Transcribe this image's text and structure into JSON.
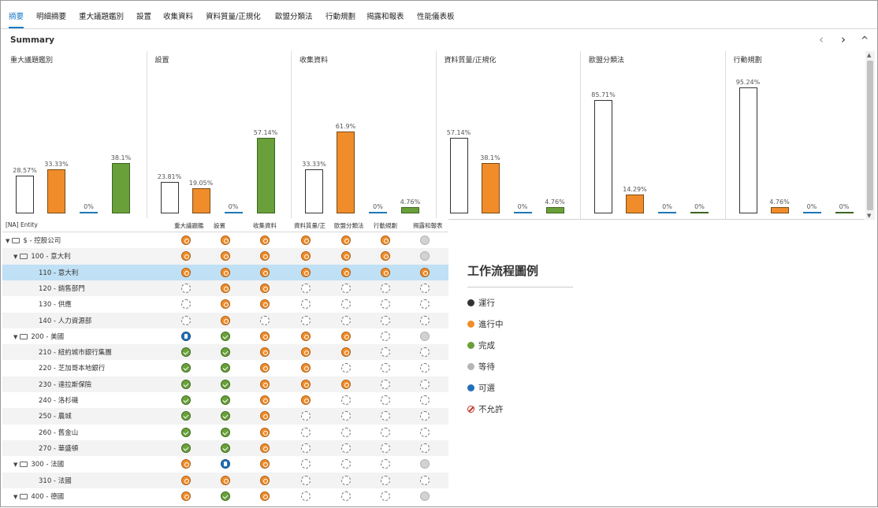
{
  "tabs": [
    "摘要",
    "明細摘要",
    "重大議題鑑別",
    "設置",
    "收集資料",
    "資料質量/正規化",
    "歐盟分類法",
    "行動規劃",
    "揭露和報表",
    "性能儀表板"
  ],
  "active_tab": 0,
  "summary": {
    "title": "Summary"
  },
  "nav": {
    "prev": "‹",
    "next": "›",
    "collapse": "^"
  },
  "status_colors": {
    "not_started": "#ffffff",
    "in_progress": "#f08d2a",
    "waiting": "#1f77b4",
    "done": "#69a03a"
  },
  "chart_data": [
    {
      "type": "bar",
      "title": "重大議題鑑別",
      "values": [
        28.57,
        33.33,
        0,
        38.1
      ],
      "labels": [
        "28.57%",
        "33.33%",
        "0%",
        "38.1%"
      ],
      "colors": [
        "#ffffff",
        "#f08d2a",
        "#1f77b4",
        "#69a03a"
      ],
      "ylim": [
        0,
        100
      ]
    },
    {
      "type": "bar",
      "title": "設置",
      "values": [
        23.81,
        19.05,
        0,
        57.14
      ],
      "labels": [
        "23.81%",
        "19.05%",
        "0%",
        "57.14%"
      ],
      "colors": [
        "#ffffff",
        "#f08d2a",
        "#1f77b4",
        "#69a03a"
      ],
      "ylim": [
        0,
        100
      ]
    },
    {
      "type": "bar",
      "title": "收集資料",
      "values": [
        33.33,
        61.9,
        0,
        4.76
      ],
      "labels": [
        "33.33%",
        "61.9%",
        "0%",
        "4.76%"
      ],
      "colors": [
        "#ffffff",
        "#f08d2a",
        "#1f77b4",
        "#69a03a"
      ],
      "ylim": [
        0,
        100
      ]
    },
    {
      "type": "bar",
      "title": "資料質量/正規化",
      "values": [
        57.14,
        38.1,
        0,
        4.76
      ],
      "labels": [
        "57.14%",
        "38.1%",
        "0%",
        "4.76%"
      ],
      "colors": [
        "#ffffff",
        "#f08d2a",
        "#1f77b4",
        "#69a03a"
      ],
      "ylim": [
        0,
        100
      ]
    },
    {
      "type": "bar",
      "title": "歐盟分類法",
      "values": [
        85.71,
        14.29,
        0,
        0
      ],
      "labels": [
        "85.71%",
        "14.29%",
        "0%",
        "0%"
      ],
      "colors": [
        "#ffffff",
        "#f08d2a",
        "#1f77b4",
        "#69a03a"
      ],
      "ylim": [
        0,
        100
      ]
    },
    {
      "type": "bar",
      "title": "行動規劃",
      "values": [
        95.24,
        4.76,
        0,
        0
      ],
      "labels": [
        "95.24%",
        "4.76%",
        "0%",
        "0%"
      ],
      "colors": [
        "#ffffff",
        "#f08d2a",
        "#1f77b4",
        "#69a03a"
      ],
      "ylim": [
        0,
        100
      ]
    }
  ],
  "grid": {
    "entity_header": "[NA] Entity",
    "columns": [
      "重大議題鑑",
      "設置",
      "收集資料",
      "資料質量/正",
      "歐盟分類法",
      "行動規劃",
      "揭露和報表"
    ],
    "rows": [
      {
        "label": "$ - 控股公司",
        "level": 0,
        "folder": true,
        "expanded": true,
        "status": [
          "ip",
          "ip",
          "ip",
          "ip",
          "ip",
          "ip",
          "wt"
        ]
      },
      {
        "label": "100 - 意大利",
        "level": 1,
        "folder": true,
        "expanded": true,
        "status": [
          "ip",
          "ip",
          "ip",
          "ip",
          "ip",
          "ip",
          "wt"
        ]
      },
      {
        "label": "110 - 意大利",
        "level": 2,
        "folder": false,
        "selected": true,
        "status": [
          "ip",
          "ip",
          "ip",
          "ip",
          "ip",
          "ip",
          "ip"
        ]
      },
      {
        "label": "120 - 銷售部門",
        "level": 2,
        "folder": false,
        "status": [
          "ns",
          "ip",
          "ip",
          "ns",
          "ns",
          "ns",
          "ns"
        ]
      },
      {
        "label": "130 - 供應",
        "level": 2,
        "folder": false,
        "status": [
          "ns",
          "ip",
          "ip",
          "ns",
          "ns",
          "ns",
          "ns"
        ]
      },
      {
        "label": "140 - 人力資源部",
        "level": 2,
        "folder": false,
        "status": [
          "ns",
          "ip",
          "ns",
          "ns",
          "ns",
          "ns",
          "ns"
        ]
      },
      {
        "label": "200 - 美國",
        "level": 1,
        "folder": true,
        "expanded": true,
        "status": [
          "op",
          "dn",
          "ip",
          "ip",
          "ip",
          "ns",
          "wt"
        ]
      },
      {
        "label": "210 - 紐約城市銀行集團",
        "level": 2,
        "folder": false,
        "status": [
          "dn",
          "dn",
          "ip",
          "ip",
          "ip",
          "ns",
          "ns"
        ]
      },
      {
        "label": "220 - 芝加哥本地銀行",
        "level": 2,
        "folder": false,
        "status": [
          "dn",
          "dn",
          "ip",
          "ip",
          "ns",
          "ns",
          "ns"
        ]
      },
      {
        "label": "230 - 達拉斯保險",
        "level": 2,
        "folder": false,
        "status": [
          "dn",
          "dn",
          "ip",
          "ip",
          "ip",
          "ns",
          "ns"
        ]
      },
      {
        "label": "240 - 洛杉磯",
        "level": 2,
        "folder": false,
        "status": [
          "dn",
          "dn",
          "ip",
          "ip",
          "ns",
          "ns",
          "ns"
        ]
      },
      {
        "label": "250 - 農城",
        "level": 2,
        "folder": false,
        "status": [
          "dn",
          "dn",
          "ip",
          "ns",
          "ns",
          "ns",
          "ns"
        ]
      },
      {
        "label": "260 - 舊金山",
        "level": 2,
        "folder": false,
        "status": [
          "dn",
          "dn",
          "ip",
          "ns",
          "ns",
          "ns",
          "ns"
        ]
      },
      {
        "label": "270 - 華盛頓",
        "level": 2,
        "folder": false,
        "status": [
          "dn",
          "dn",
          "ip",
          "ns",
          "ns",
          "ns",
          "ns"
        ]
      },
      {
        "label": "300 - 法國",
        "level": 1,
        "folder": true,
        "expanded": true,
        "status": [
          "ip",
          "op",
          "ip",
          "ns",
          "ns",
          "ns",
          "wt"
        ]
      },
      {
        "label": "310 - 法國",
        "level": 2,
        "folder": false,
        "status": [
          "ip",
          "ip",
          "ip",
          "ns",
          "ns",
          "ns",
          "ns"
        ]
      },
      {
        "label": "400 - 德國",
        "level": 1,
        "folder": true,
        "expanded": true,
        "status": [
          "ip",
          "dn",
          "ip",
          "ns",
          "ns",
          "ns",
          "wt"
        ]
      }
    ]
  },
  "legend": {
    "title": "工作流程圖例",
    "items": [
      {
        "label": "運行",
        "color": "#333333"
      },
      {
        "label": "進行中",
        "color": "#f08d2a"
      },
      {
        "label": "完成",
        "color": "#69a03a"
      },
      {
        "label": "等待",
        "color": "#b5b5b5"
      },
      {
        "label": "可選",
        "color": "#2370b8"
      },
      {
        "label": "不允許",
        "color": "not-allowed"
      }
    ]
  }
}
